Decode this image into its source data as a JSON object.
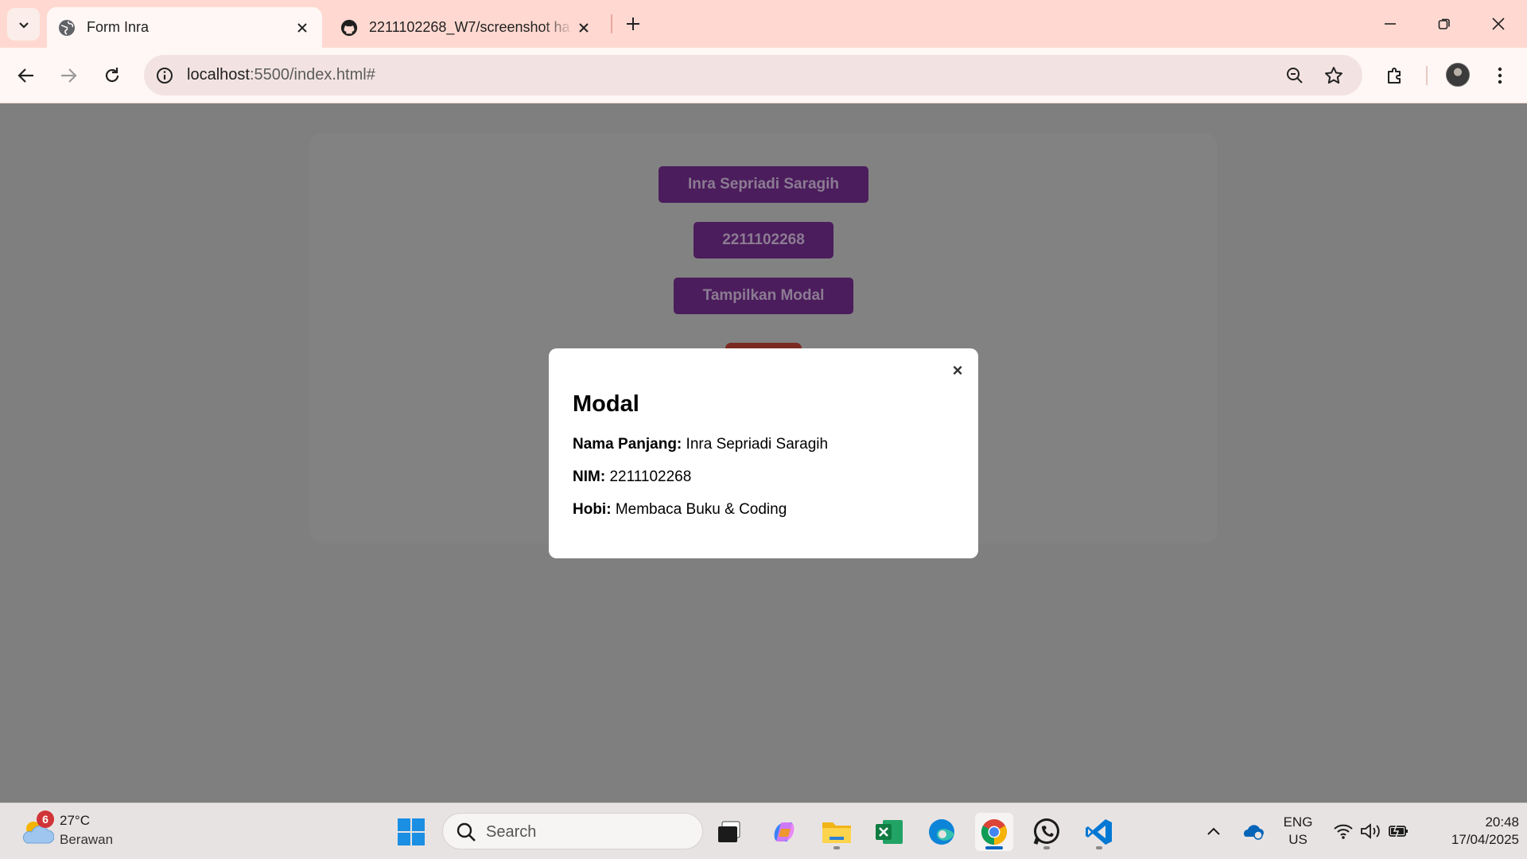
{
  "browser": {
    "tabs": [
      {
        "title": "Form Inra",
        "active": true,
        "favicon": "globe-icon"
      },
      {
        "title": "2211102268_W7/screenshot ha",
        "active": false,
        "favicon": "github-icon"
      }
    ],
    "address": {
      "host": "localhost",
      "rest": ":5500/index.html#"
    }
  },
  "page": {
    "buttons": {
      "name": "Inra Sepriadi Saragih",
      "nim": "2211102268",
      "show_modal": "Tampilkan Modal"
    },
    "colors": {
      "button_bg": "#4b1d5c",
      "overlay": "#7f7f7f",
      "card": "#828282",
      "red_button": "#7a2a22"
    }
  },
  "modal": {
    "close_glyph": "×",
    "title": "Modal",
    "rows": [
      {
        "label": "Nama Panjang:",
        "value": "Inra Sepriadi Saragih"
      },
      {
        "label": "NIM:",
        "value": "2211102268"
      },
      {
        "label": "Hobi:",
        "value": "Membaca Buku & Coding"
      }
    ]
  },
  "taskbar": {
    "weather": {
      "badge": "6",
      "temp": "27°C",
      "desc": "Berawan"
    },
    "search_placeholder": "Search",
    "lang": {
      "line1": "ENG",
      "line2": "US"
    },
    "clock": {
      "time": "20:48",
      "date": "17/04/2025"
    }
  }
}
